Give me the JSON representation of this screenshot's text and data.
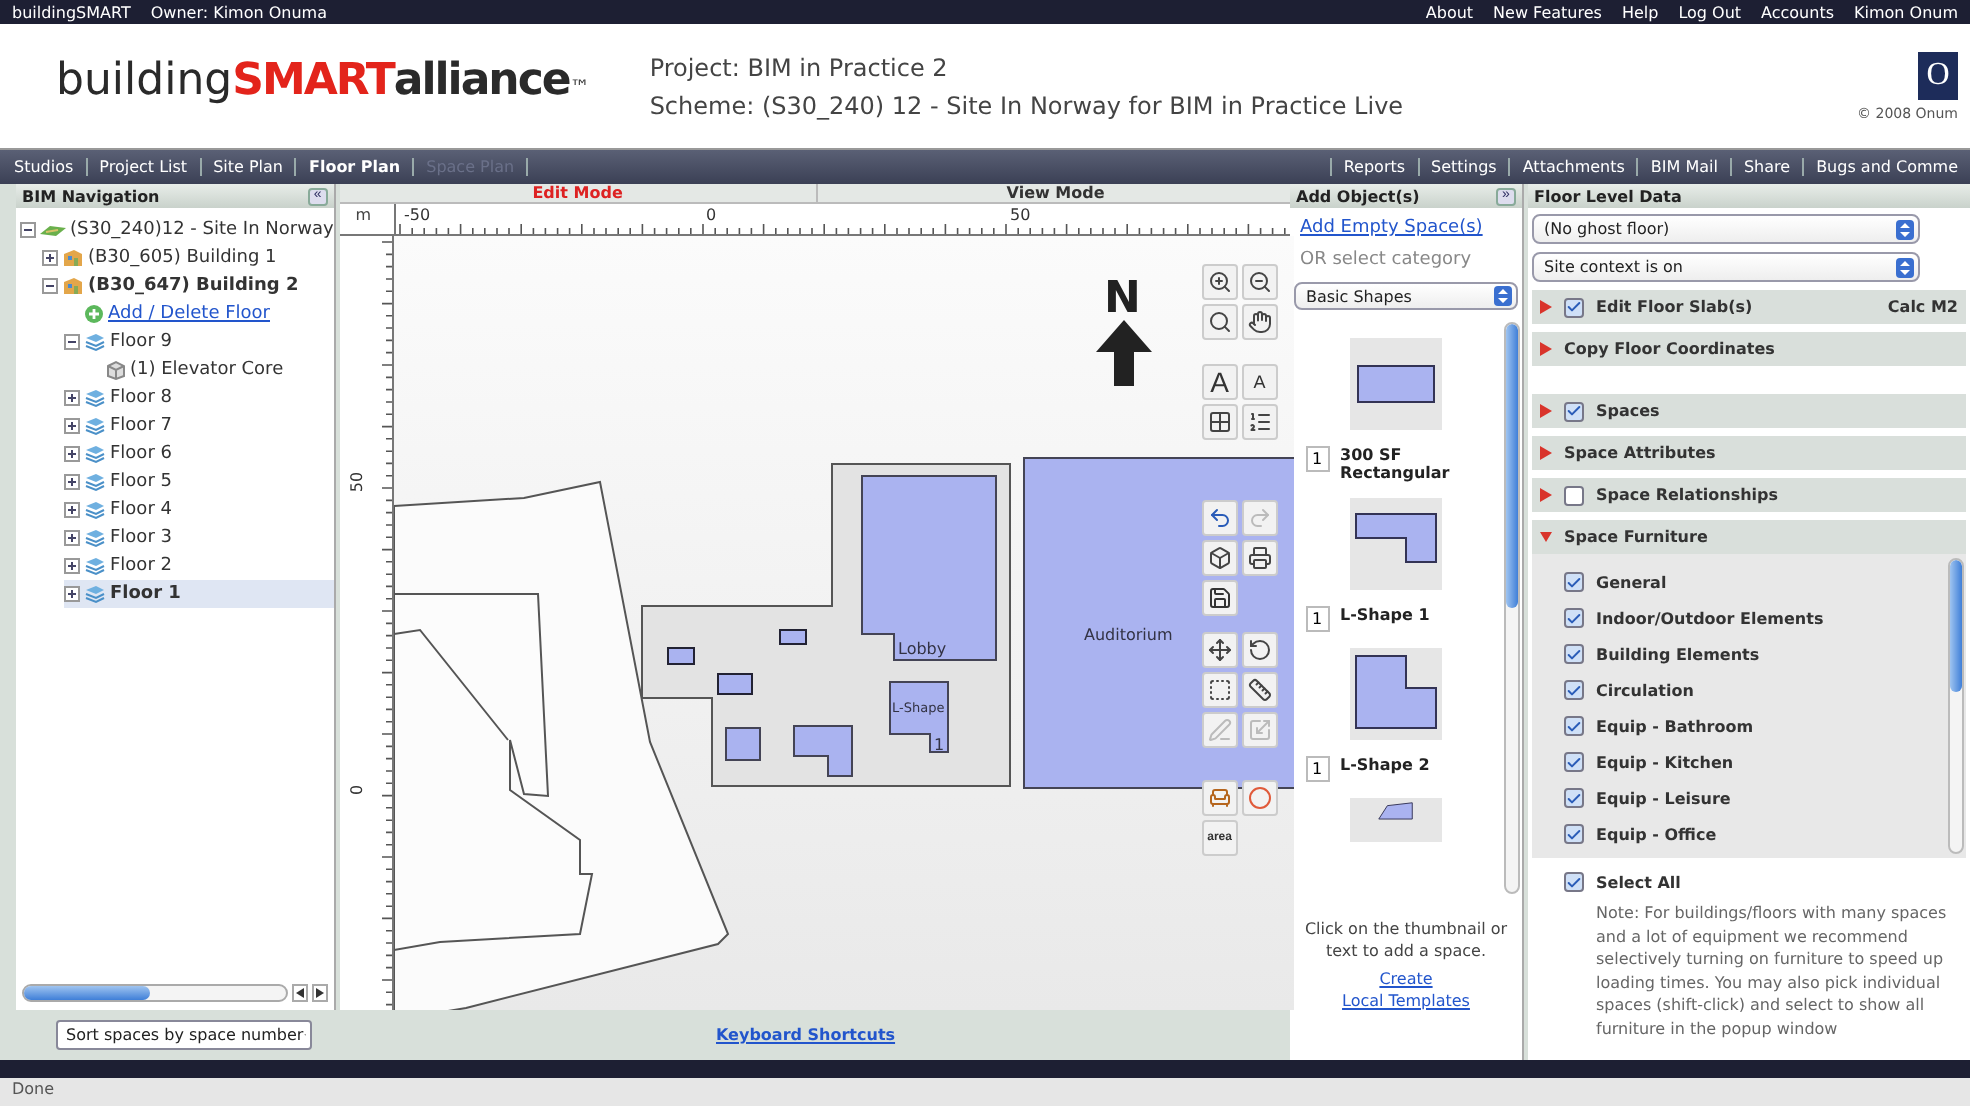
{
  "top_bar": {
    "left": [
      "buildingSMART",
      "Owner: Kimon Onuma"
    ],
    "links": [
      "About",
      "New Features",
      "Help",
      "Log Out",
      "Accounts",
      "Kimon Onum"
    ]
  },
  "header": {
    "logo": [
      {
        "text": "building",
        "kind": "light"
      },
      {
        "text": "SMART",
        "kind": "accent"
      },
      {
        "text": "alliance",
        "kind": "bold"
      }
    ],
    "trademark": "™",
    "project": "Project: BIM in Practice 2",
    "scheme": "Scheme: (S30_240) 12 - Site In Norway for BIM in Practice Live",
    "corner_logo": "O",
    "copyright": "© 2008 Onum"
  },
  "nav_tabs": [
    {
      "label": "Studios",
      "selected": false,
      "disabled": false
    },
    {
      "label": "Project List",
      "selected": false,
      "disabled": false
    },
    {
      "label": "Site Plan",
      "selected": false,
      "disabled": false
    },
    {
      "label": "Floor Plan",
      "selected": true,
      "disabled": false
    },
    {
      "label": "Space Plan",
      "selected": false,
      "disabled": true
    }
  ],
  "nav_right": [
    "Reports",
    "Settings",
    "Attachments",
    "BIM Mail",
    "Share",
    "Bugs and Comme"
  ],
  "bim_navigation": {
    "title": "BIM Navigation",
    "collapse": "«",
    "tree": [
      {
        "label": "(S30_240)12 - Site In Norway",
        "kind": "site",
        "expanded": true,
        "selected": false,
        "children": [
          {
            "label": "(B30_605) Building 1",
            "kind": "building",
            "expanded": false,
            "selected": false
          },
          {
            "label": "(B30_647) Building 2",
            "kind": "building",
            "expanded": true,
            "selected": false,
            "bold": true,
            "children": [
              {
                "label": "Add / Delete Floor",
                "kind": "link"
              },
              {
                "label": "Floor 9",
                "kind": "floor",
                "expanded": true,
                "selected": false,
                "children": [
                  {
                    "label": "(1) Elevator Core",
                    "kind": "space",
                    "selected": false
                  }
                ]
              },
              {
                "label": "Floor 8",
                "kind": "floor",
                "expanded": false,
                "selected": false
              },
              {
                "label": "Floor 7",
                "kind": "floor",
                "expanded": false,
                "selected": false
              },
              {
                "label": "Floor 6",
                "kind": "floor",
                "expanded": false,
                "selected": false
              },
              {
                "label": "Floor 5",
                "kind": "floor",
                "expanded": false,
                "selected": false
              },
              {
                "label": "Floor 4",
                "kind": "floor",
                "expanded": false,
                "selected": false
              },
              {
                "label": "Floor 3",
                "kind": "floor",
                "expanded": false,
                "selected": false
              },
              {
                "label": "Floor 2",
                "kind": "floor",
                "expanded": false,
                "selected": false
              },
              {
                "label": "Floor 1",
                "kind": "floor",
                "expanded": false,
                "selected": true,
                "bold": true
              }
            ]
          }
        ]
      }
    ]
  },
  "sort_select": "Sort spaces by space number",
  "canvas": {
    "modes": [
      {
        "label": "Edit Mode",
        "selected": true
      },
      {
        "label": "View Mode",
        "selected": false
      }
    ],
    "unit": "m",
    "x_ticks": [
      "-50",
      "0",
      "50"
    ],
    "y_ticks": [
      "50",
      "0"
    ],
    "north": "N",
    "room_labels": [
      "Lobby",
      "L-Shape",
      "1",
      "Auditorium"
    ],
    "tool_groups": [
      [
        {
          "kind": "zoom-in",
          "disabled": false
        },
        {
          "kind": "zoom-out",
          "disabled": false
        },
        {
          "kind": "zoom-window",
          "disabled": false
        },
        {
          "kind": "pan",
          "disabled": false
        }
      ],
      [
        {
          "kind": "text-large",
          "label": "A",
          "disabled": false
        },
        {
          "kind": "text-small",
          "label": "A",
          "disabled": false
        },
        {
          "kind": "auto",
          "disabled": false
        },
        {
          "kind": "numbering",
          "disabled": false
        }
      ],
      [
        {
          "kind": "undo",
          "disabled": false
        },
        {
          "kind": "redo",
          "disabled": true
        },
        {
          "kind": "cube",
          "disabled": false
        },
        {
          "kind": "print",
          "disabled": false
        },
        {
          "kind": "save",
          "disabled": false
        }
      ],
      [
        {
          "kind": "move",
          "disabled": false
        },
        {
          "kind": "rotate",
          "disabled": false
        },
        {
          "kind": "select",
          "disabled": false
        },
        {
          "kind": "ruler",
          "disabled": false
        },
        {
          "kind": "pen",
          "disabled": true
        },
        {
          "kind": "scale",
          "disabled": true
        }
      ],
      [
        {
          "kind": "furniture",
          "disabled": false
        },
        {
          "kind": "circle",
          "disabled": false
        },
        {
          "kind": "area",
          "label": "area",
          "disabled": false
        }
      ]
    ]
  },
  "keyboard_link": "Keyboard Shortcuts",
  "add_objects": {
    "title": "Add Object(s)",
    "expand": "»",
    "add_link": "Add Empty Space(s)",
    "category_label": "OR select category",
    "category": "Basic Shapes",
    "shapes": [
      {
        "kind": "rectangle",
        "quantity": "1",
        "name": "300 SF Rectangular"
      },
      {
        "kind": "l-shape",
        "quantity": "1",
        "name": "L-Shape 1"
      },
      {
        "kind": "l-shape-2",
        "quantity": "1",
        "name": "L-Shape 2"
      },
      {
        "kind": "irregular"
      }
    ],
    "hint": "Click on the thumbnail or text to add a space.",
    "links": [
      "Create",
      "Local Templates"
    ]
  },
  "floor_level": {
    "title": "Floor Level Data",
    "selects": [
      "(No ghost floor)",
      "Site context is on"
    ],
    "section_groups": [
      [
        {
          "label": "Edit Floor Slab(s)",
          "kind": "check",
          "checked": true,
          "expanded": false,
          "extra": "Calc M2"
        },
        {
          "label": "Copy Floor Coordinates",
          "kind": "plain",
          "expanded": false
        }
      ],
      [
        {
          "label": "Spaces",
          "kind": "check",
          "checked": true,
          "expanded": false
        },
        {
          "label": "Space Attributes",
          "kind": "plain",
          "expanded": false
        },
        {
          "label": "Space Relationships",
          "kind": "check",
          "checked": false,
          "expanded": false
        },
        {
          "label": "Space Furniture",
          "kind": "plain",
          "expanded": true
        }
      ]
    ],
    "furniture": [
      {
        "label": "General",
        "checked": true
      },
      {
        "label": "Indoor/Outdoor Elements",
        "checked": true
      },
      {
        "label": "Building Elements",
        "checked": true
      },
      {
        "label": "Circulation",
        "checked": true
      },
      {
        "label": "Equip - Bathroom",
        "checked": true
      },
      {
        "label": "Equip - Kitchen",
        "checked": true
      },
      {
        "label": "Equip - Leisure",
        "checked": true
      },
      {
        "label": "Equip - Office",
        "checked": true
      }
    ],
    "select_all": {
      "label": "Select All",
      "checked": true
    },
    "note": "Note: For buildings/floors with many spaces and a lot of equipment we recommend selectively turning on furniture to speed up loading times. You may also pick individual spaces (shift-click) and select to show all furniture in the popup window"
  },
  "status": "Done"
}
